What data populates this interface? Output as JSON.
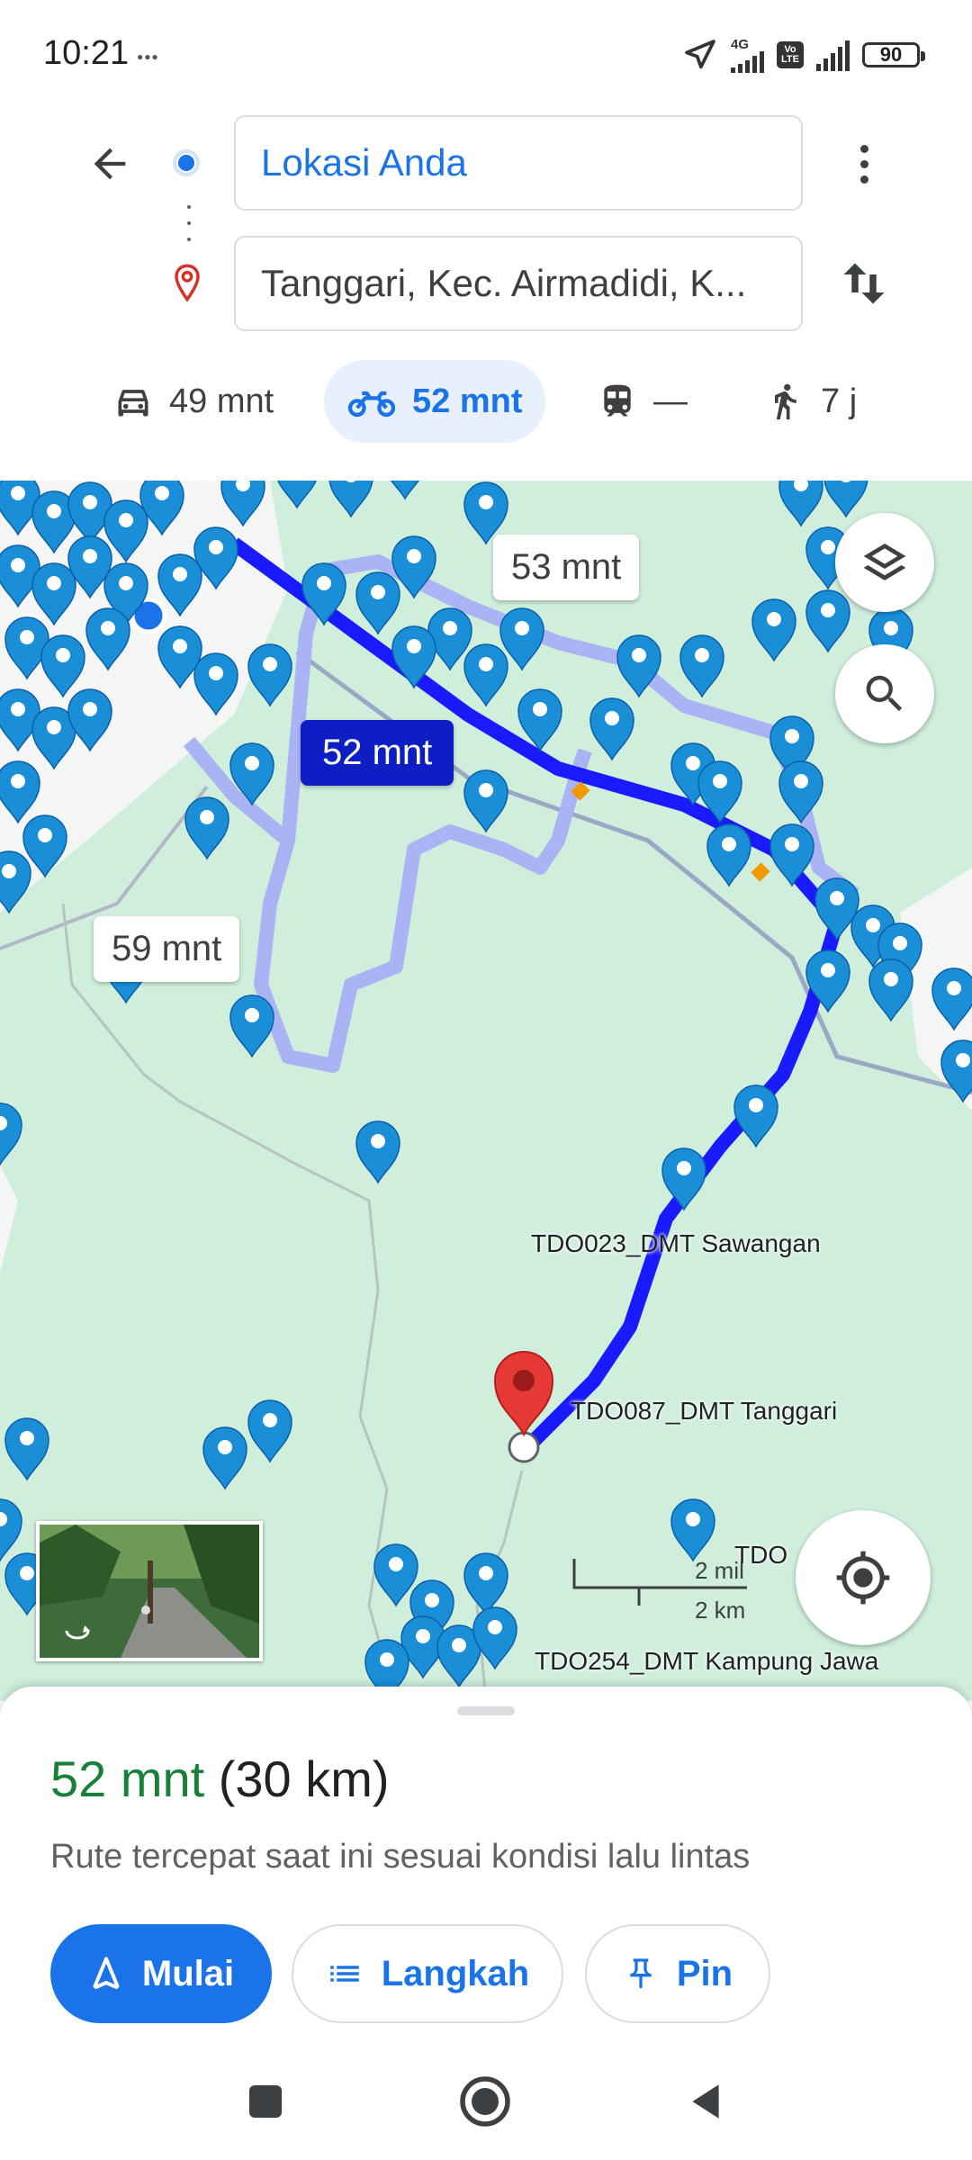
{
  "status_bar": {
    "time": "10:21",
    "network_type": "4G",
    "volte": "Vo LTE",
    "battery": "90"
  },
  "header": {
    "origin": "Lokasi Anda",
    "destination": "Tanggari, Kec. Airmadidi, K..."
  },
  "modes": [
    {
      "icon": "car-icon",
      "label": "49 mnt"
    },
    {
      "icon": "motorcycle-icon",
      "label": "52 mnt",
      "active": true
    },
    {
      "icon": "transit-icon",
      "label": "—"
    },
    {
      "icon": "walk-icon",
      "label": "7 j"
    }
  ],
  "map": {
    "route_times": {
      "main": "52 mnt",
      "alt1": "53 mnt",
      "alt2": "59 mnt"
    },
    "labels": {
      "sawangan": "TDO023_DMT Sawangan",
      "tanggari": "TDO087_DMT Tanggari",
      "kampung_jawa": "TDO254_DMT Kampung Jawa",
      "partial": "TDO"
    },
    "scale": {
      "mi": "2 mil",
      "km": "2 km"
    },
    "colors": {
      "route": "#1a1aff",
      "alt_route": "#aab4f5",
      "map_bg": "#cfeedb",
      "pin": "#1a8fd8",
      "destination_pin": "#e53935"
    }
  },
  "sheet": {
    "duration": "52 mnt",
    "distance": "(30 km)",
    "description": "Rute tercepat saat ini sesuai kondisi lalu lintas",
    "buttons": {
      "start": "Mulai",
      "steps": "Langkah",
      "pin": "Pin"
    }
  }
}
